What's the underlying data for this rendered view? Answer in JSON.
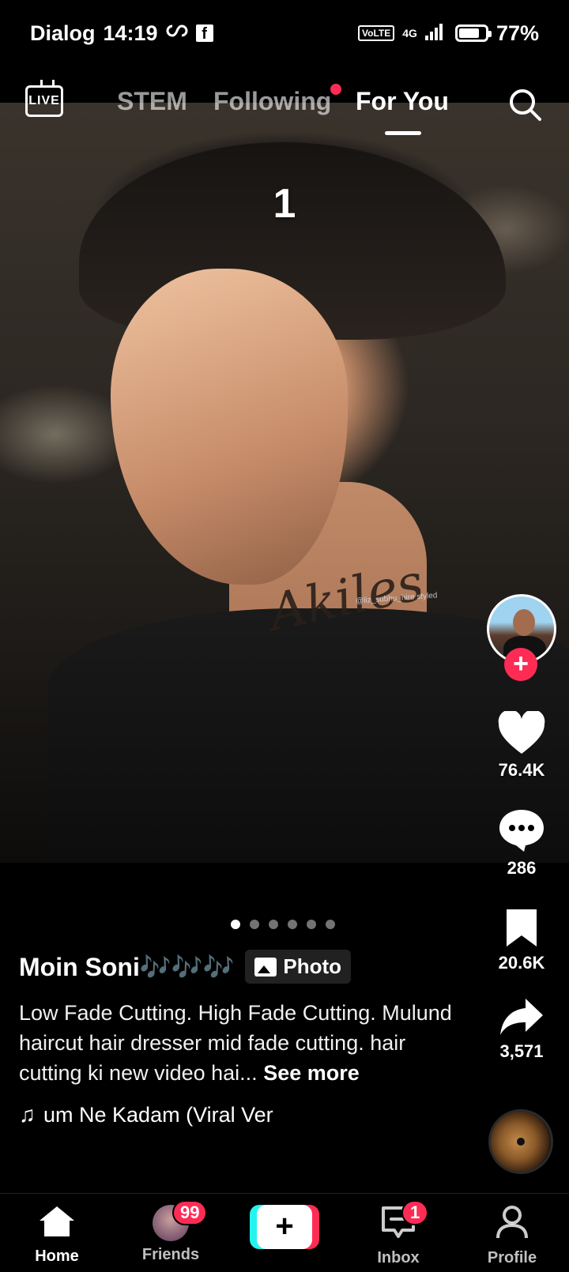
{
  "status_bar": {
    "carrier": "Dialog",
    "time": "14:19",
    "network_badge": "VoLTE",
    "network_type": "4G",
    "battery": "77%",
    "battery_level": 0.77,
    "icons": [
      "loop-icon",
      "facebook-icon",
      "signal-icon",
      "battery-icon"
    ]
  },
  "top_nav": {
    "live_label": "LIVE",
    "tabs": [
      {
        "label": "STEM",
        "active": false
      },
      {
        "label": "Following",
        "active": false,
        "has_dot": true
      },
      {
        "label": "For You",
        "active": true
      }
    ]
  },
  "post": {
    "slide_number": "1",
    "slides_total": 6,
    "current_slide": 1,
    "tattoo_text": "Akiles",
    "watermark_handle": "@liz_subhu_hire styled",
    "author": "Moin Soni🎶🎶🎶",
    "type_badge": "Photo",
    "description": "Low Fade Cutting. High Fade Cutting.  Mulund haircut hair dresser  mid fade cutting.    hair cutting ki new video hai...",
    "see_more": "See more",
    "sound": "um Ne Kadam (Viral Ver"
  },
  "actions": {
    "likes": "76.4K",
    "comments": "286",
    "saves": "20.6K",
    "shares": "3,571"
  },
  "bottom_nav": {
    "home": "Home",
    "friends": "Friends",
    "friends_badge": "99",
    "create": "+",
    "inbox": "Inbox",
    "inbox_badge": "1",
    "profile": "Profile"
  },
  "colors": {
    "accent": "#fe2c55",
    "cyan": "#25f4ee",
    "background": "#000000"
  }
}
